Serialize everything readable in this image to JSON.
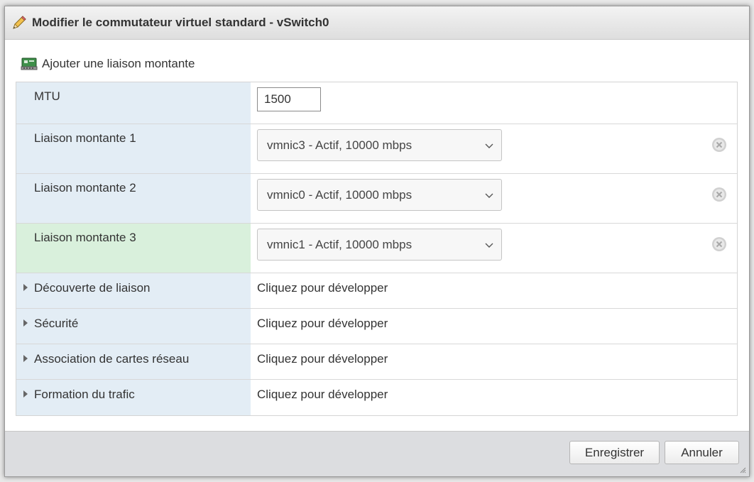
{
  "dialog": {
    "title": "Modifier le commutateur virtuel standard - vSwitch0",
    "title_icon": "pencil-icon"
  },
  "toolbar": {
    "add_uplink_label": "Ajouter une liaison montante",
    "add_uplink_icon": "network-card-icon"
  },
  "rows": {
    "mtu": {
      "label": "MTU",
      "value": "1500"
    },
    "uplink1": {
      "label": "Liaison montante 1",
      "value": "vmnic3 - Actif, 10000 mbps"
    },
    "uplink2": {
      "label": "Liaison montante 2",
      "value": "vmnic0 - Actif, 10000 mbps"
    },
    "uplink3": {
      "label": "Liaison montante 3",
      "value": "vmnic1 - Actif, 10000 mbps"
    },
    "link_discovery": {
      "label": "Découverte de liaison",
      "value": "Cliquez pour développer"
    },
    "security": {
      "label": "Sécurité",
      "value": "Cliquez pour développer"
    },
    "nic_teaming": {
      "label": "Association de cartes réseau",
      "value": "Cliquez pour développer"
    },
    "traffic_shaping": {
      "label": "Formation du trafic",
      "value": "Cliquez pour développer"
    }
  },
  "footer": {
    "save_label": "Enregistrer",
    "cancel_label": "Annuler"
  },
  "colors": {
    "label_bg": "#e3edf5",
    "label_bg_selected": "#d9f0dc",
    "footer_bg": "#dcdde0"
  }
}
